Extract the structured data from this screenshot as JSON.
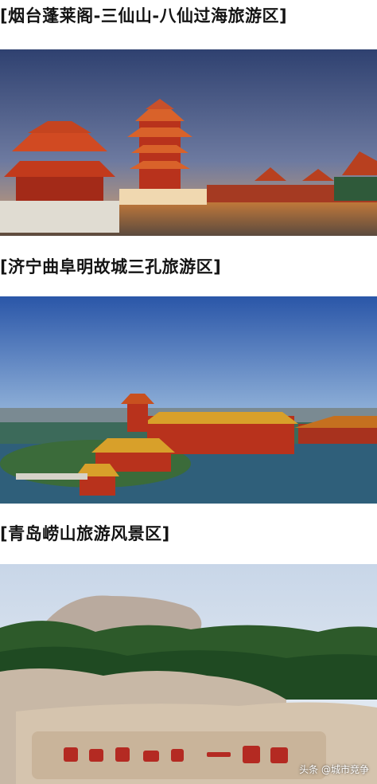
{
  "sections": [
    {
      "heading": "[烟台蓬莱阁-三仙山-八仙过海旅游区]",
      "photo": "penglai-pavilion-photo"
    },
    {
      "heading": "[济宁曲阜明故城三孔旅游区]",
      "photo": "qufu-temple-photo"
    },
    {
      "heading": "[青岛崂山旅游风景区]",
      "photo": "laoshan-mountain-photo"
    }
  ],
  "watermark": "头条 @城市竞争",
  "colors": {
    "sky_dusk": "#3a4d7a",
    "sky_blue": "#3468b5",
    "roof_red": "#b8321c",
    "roof_gold": "#d79a2b",
    "water": "#2c5a78"
  }
}
